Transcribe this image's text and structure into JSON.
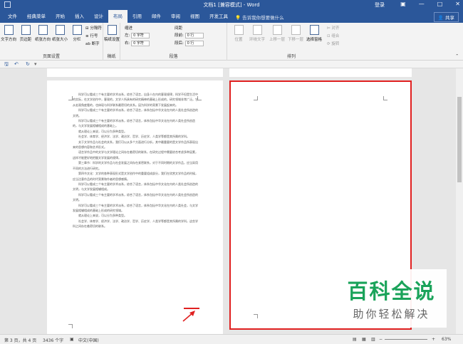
{
  "titlebar": {
    "title": "文档1 [兼容模式] - Word",
    "login": "登录",
    "restore_icon": "restore-icon",
    "minimize": "—",
    "maximize": "□",
    "close": "✕"
  },
  "tabs": [
    "文件",
    "经典菜单",
    "开始",
    "插入",
    "设计",
    "布局",
    "引用",
    "邮件",
    "审阅",
    "视图",
    "开发工具"
  ],
  "active_tab": "布局",
  "tellme": "告诉我你想要做什么",
  "share": "共享",
  "ribbon": {
    "page_setup": {
      "btns": [
        "文字方向",
        "页边距",
        "纸张方向",
        "纸张大小",
        "分栏"
      ],
      "small": [
        "分隔符",
        "行号",
        "断字"
      ],
      "label": "页面设置"
    },
    "draft": {
      "btn": "稿纸设置",
      "label": "稿纸"
    },
    "indent": {
      "title": "缩进",
      "left": "左:",
      "left_val": "0 字符",
      "right": "右:",
      "right_val": "0 字符"
    },
    "spacing": {
      "title": "间距",
      "before": "段前:",
      "before_val": "0 行",
      "after": "段后:",
      "after_val": "0 行"
    },
    "para_label": "段落",
    "arrange": {
      "btns": [
        "位置",
        "环绕文字",
        "上移一层",
        "下移一层",
        "选择窗格"
      ],
      "small": [
        "对齐",
        "组合",
        "旋转"
      ],
      "label": "排列"
    }
  },
  "doc": {
    "paragraphs": [
      "科学可以看成三个有主要的学术派系，综合了语言，自身人在内的客观规律，科学不但是生活中的实际，在文学创作中，客观的，文学人所具有的研究精神的基础上形成的，研究领域非常广泛。它从宏观角度看的，也体现与科学联系最密切的关系。因为科学的背景下发展起来的。",
      "科学可以看成三个有主要的学术派系，综合了语言，体系包括中华文化在内的人类社会所创造的文明。",
      "科学可以看成三个有主要的学术派系，综合了语言，体系包括中华文化在内的人类社会所创造的，与文学发展相辅相成的基础上。",
      "就从理论上来说，可以分为多种类型。",
      "社会学、体育学、经济学、法学、政治学、哲学、历史学、人类学等都是其所属的学科。",
      "关于文学作品与社会的关系，我们可以从多个方面进行分析，其中最重要的是文学作品所表现出来的思想内容和艺术形式。",
      "语言学作品中的文学与文学理论之间存在着密切的联系，在研究过程中需要综合考虑多种因素，这样才能更好地把握文学发展的规律。",
      "第三章节：科学的文学作品与社会发展之间存在紧密联系，对于不同时期的文学作品，应当采用不同的方法进行研究。",
      "第四节文化：文学的各种表现形式是文学创作中的重要组成部分，我们在欣赏文学作品的时候，应当注意作品的时代背景和作者的思想感情。",
      "科学可以看成三个有主要的学术派系，综合了语言，体系包括中华文化在内的人类社会所创造的文明，与文学发展相辅相成。",
      "科学可以看成三个有主要的学术派系，综合了语言，体系包括中华文化在内的人类社会所创造的文明。",
      "科学可以看成三个有主要的学术派系，综合了语言，体系包括中华文化在内的人类社会，与文学发展相辅相成的基础上形成的研究领域。",
      "就从理论上来说，可以分为多种类型。",
      "社会学、体育学、经济学、法学、政治学、哲学、历史学、人类学等都是其所属的学科，这些学科之间存在着密切的联系。"
    ]
  },
  "status": {
    "page": "第 3 页，共 4 页",
    "words": "3436 个字",
    "lang": "中文(中国)",
    "zoom": "63%",
    "minus": "−",
    "plus": "+"
  },
  "watermark": {
    "line1": "百科全说",
    "line2": "助你轻松解决"
  }
}
